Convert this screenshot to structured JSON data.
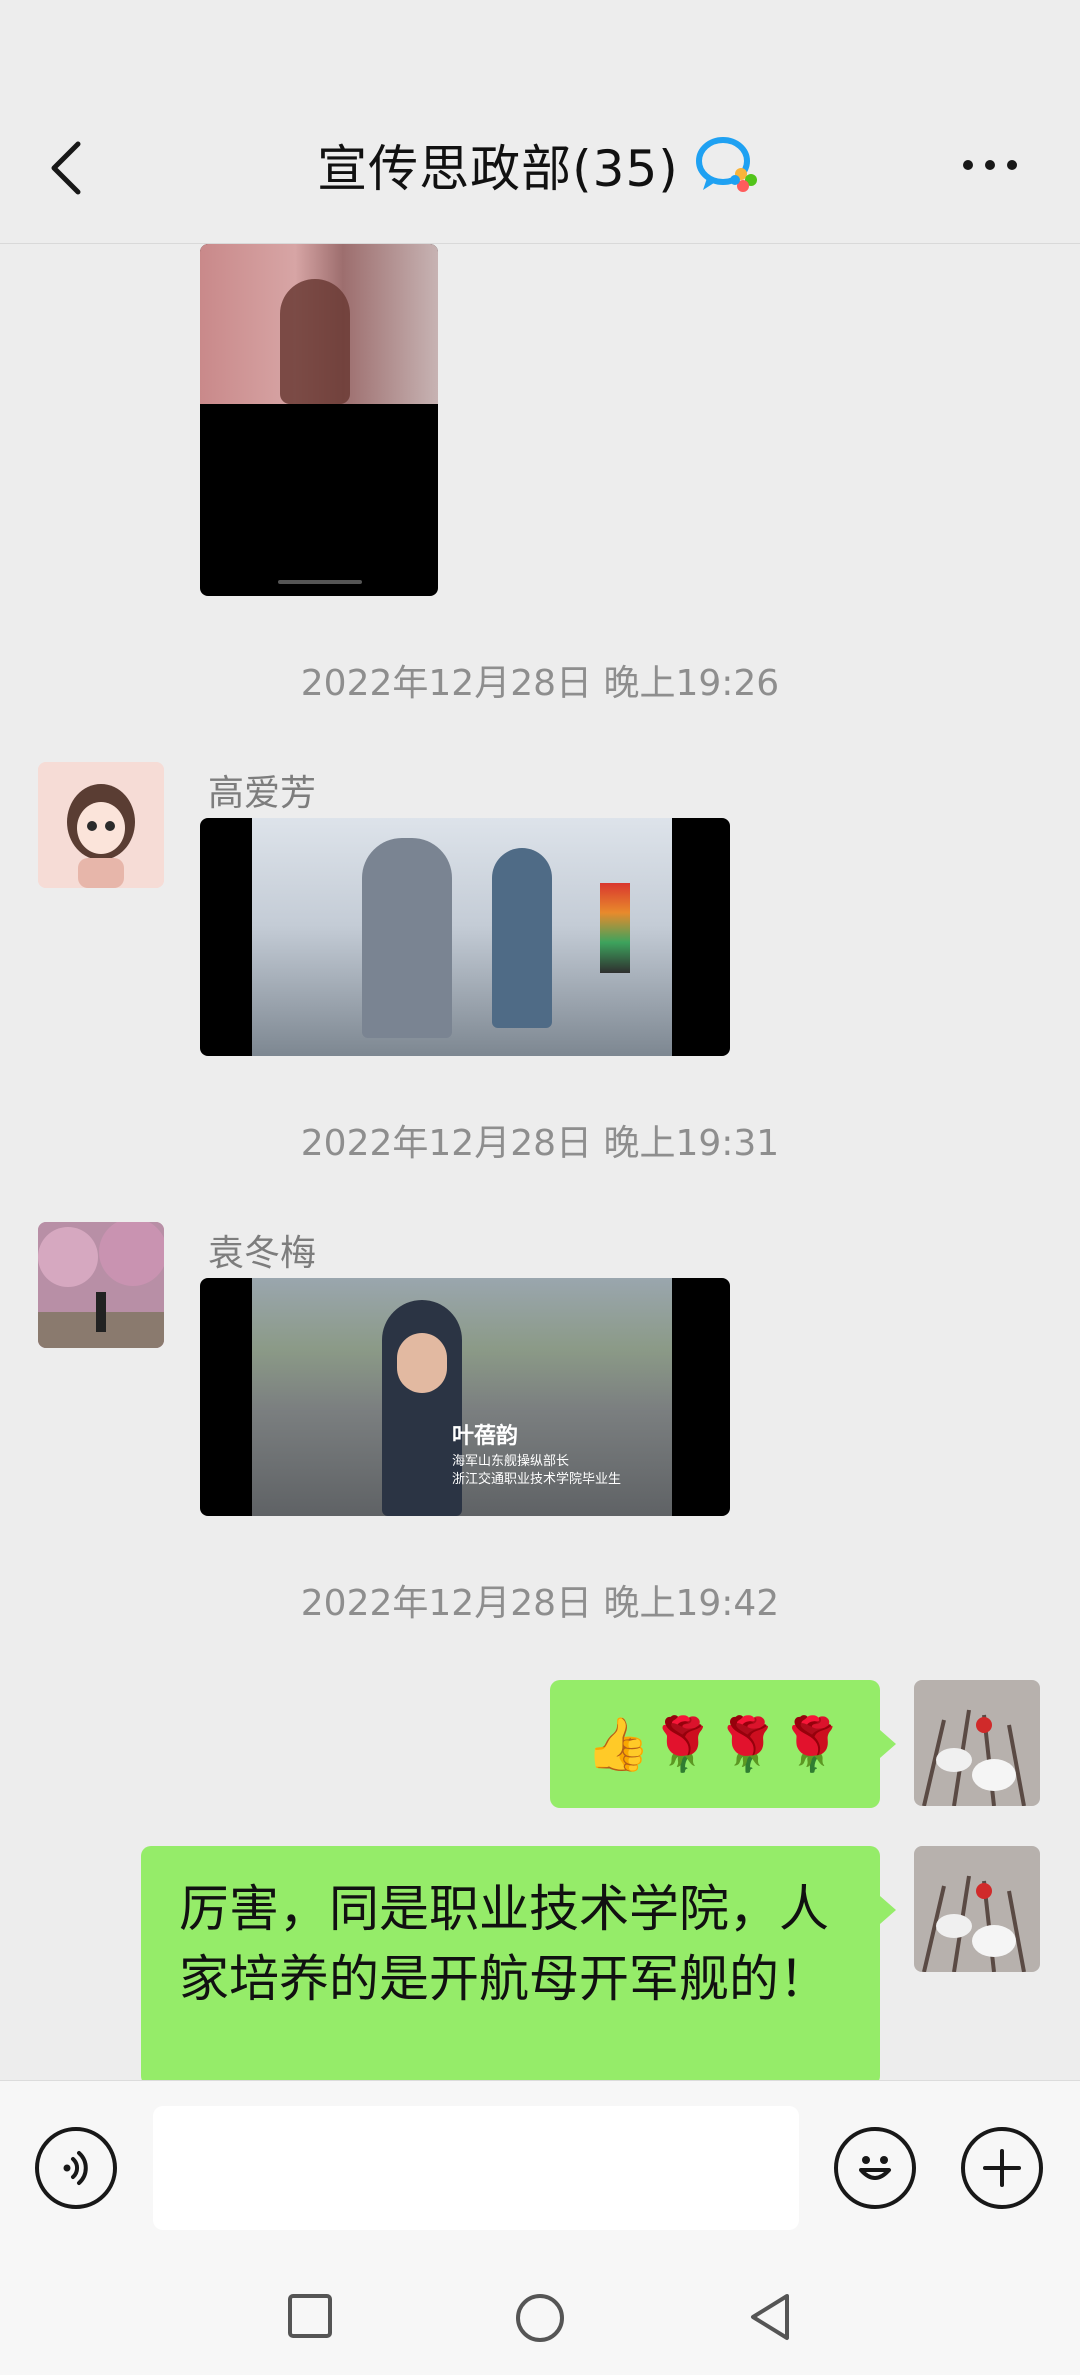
{
  "header": {
    "title": "宣传思政部(35)",
    "back_icon": "chevron-left-icon",
    "group_icon": "group-chat-icon",
    "more_icon": "more-dots-icon"
  },
  "messages": {
    "ts1": "2022年12月28日 晚上19:26",
    "sender1": "高爱芳",
    "ts2": "2022年12月28日 晚上19:31",
    "sender2": "袁冬梅",
    "video2_caption_name": "叶蓓韵",
    "video2_caption_line1": "海军山东舰操纵部长",
    "video2_caption_line2": "浙江交通职业技术学院毕业生",
    "ts3": "2022年12月28日 晚上19:42",
    "emoji_msg": "👍🌹🌹🌹",
    "text_msg": "厉害，同是职业技术学院，人家培养的是开航母开军舰的！"
  },
  "input_bar": {
    "voice_icon": "voice-icon",
    "emoji_icon": "emoji-icon",
    "plus_icon": "plus-icon",
    "placeholder": ""
  },
  "system_nav": {
    "recent_icon": "square-icon",
    "home_icon": "circle-icon",
    "back_icon": "triangle-back-icon"
  },
  "colors": {
    "background": "#ededed",
    "bubble_green": "#95ec69",
    "timestamp_gray": "#8e8e8e"
  }
}
